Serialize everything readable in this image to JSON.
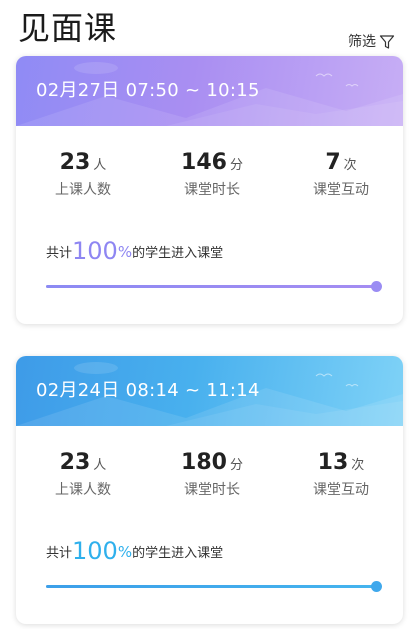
{
  "header": {
    "title": "见面课",
    "filter_label": "筛选",
    "filter_icon": "filter-icon"
  },
  "sessions": [
    {
      "time_range": "02月27日 07:50 ~ 10:15",
      "theme": "purple",
      "stats": [
        {
          "value": "23",
          "unit": "人",
          "label": "上课人数"
        },
        {
          "value": "146",
          "unit": "分",
          "label": "课堂时长"
        },
        {
          "value": "7",
          "unit": "次",
          "label": "课堂互动"
        }
      ],
      "summary_prefix": "共计",
      "summary_percent": "100",
      "summary_percent_sign": "%",
      "summary_suffix": "的学生进入课堂",
      "progress": 1.0
    },
    {
      "time_range": "02月24日 08:14 ~ 11:14",
      "theme": "blue",
      "stats": [
        {
          "value": "23",
          "unit": "人",
          "label": "上课人数"
        },
        {
          "value": "180",
          "unit": "分",
          "label": "课堂时长"
        },
        {
          "value": "13",
          "unit": "次",
          "label": "课堂互动"
        }
      ],
      "summary_prefix": "共计",
      "summary_percent": "100",
      "summary_percent_sign": "%",
      "summary_suffix": "的学生进入课堂",
      "progress": 1.0
    }
  ],
  "colors": {
    "purple_accent": "#8e86f2",
    "blue_accent": "#2fb0ec"
  }
}
